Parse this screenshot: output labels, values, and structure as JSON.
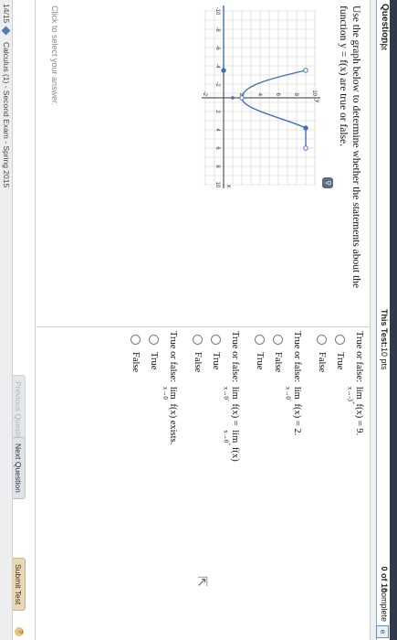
{
  "header": {
    "question_label": "Question:",
    "question_points": "1 pt",
    "test_label": "This Test:",
    "test_points": "10 pts",
    "score": "0 of 10",
    "complete_label": "complete",
    "corner_icon": "e-icon"
  },
  "question": {
    "text": "Use the graph below to determine whether the statements about the function y = f(x) are true or false.",
    "zoom_icon": "magnifier-icon",
    "hint": "Click to select your answer."
  },
  "graph": {
    "y_axis_label": "y",
    "x_axis_label": "x",
    "x_ticks": [
      "-10",
      "-8",
      "-6",
      "-4",
      "-2",
      "2",
      "4",
      "6",
      "8",
      "10"
    ],
    "y_ticks": [
      "10",
      "8",
      "6",
      "4",
      "2",
      "-2"
    ],
    "curve_color": "#3f6fb5"
  },
  "questions": [
    {
      "prefix": "True or false:",
      "lim": "lim",
      "sub": "x→-3",
      "sup": "+",
      "expr": "f(x) = 9.",
      "options": [
        "True",
        "False"
      ]
    },
    {
      "prefix": "True or false:",
      "lim": "lim",
      "sub": "x→0",
      "sup": "-",
      "expr": "f(x) = 2.",
      "options": [
        "False",
        "True"
      ]
    },
    {
      "prefix": "True or false:",
      "lim": "lim",
      "sub": "x→0",
      "sup": "-",
      "expr": "f(x) =",
      "lim2": "lim",
      "sub2": "x→0",
      "sup2": "+",
      "expr2": "f(x)",
      "options": [
        "True",
        "False"
      ]
    },
    {
      "prefix": "True or false:",
      "lim": "lim",
      "sub": "x→0",
      "expr": "f(x) exists.",
      "options": [
        "True",
        "False"
      ]
    }
  ],
  "buttons": {
    "previous": "Previous Question",
    "next": "Next Question",
    "submit": "Submit Test",
    "help_icon": "help-icon"
  },
  "footer": {
    "counter": "14/15",
    "title": "Calculus (1) - Second Exam - Spring 2015"
  }
}
